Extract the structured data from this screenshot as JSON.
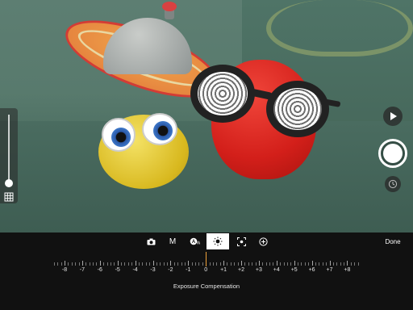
{
  "modes": {
    "camera_icon": "camera-icon",
    "manual_label": "M",
    "auto_white_balance_icon": "awb-icon",
    "exposure_icon": "sun-icon",
    "focus_icon": "focus-icon",
    "zoom_icon": "zoom-icon",
    "active": "exposure"
  },
  "done_label": "Done",
  "exposure": {
    "current_value": 0,
    "scale_labels": [
      "-8",
      "-7",
      "-6",
      "-5",
      "-4",
      "-3",
      "-2",
      "-1",
      "0",
      "+1",
      "+2",
      "+3",
      "+4",
      "+5",
      "+6",
      "+7",
      "+8"
    ],
    "caption": "Exposure Compensation"
  },
  "controls": {
    "grid_icon": "grid-icon",
    "play_icon": "play-icon",
    "shutter_icon": "shutter-icon",
    "timer_icon": "clock-icon"
  },
  "colors": {
    "accent": "#f0a23a",
    "bar_background": "#111111",
    "text": "#e6e6e6"
  }
}
